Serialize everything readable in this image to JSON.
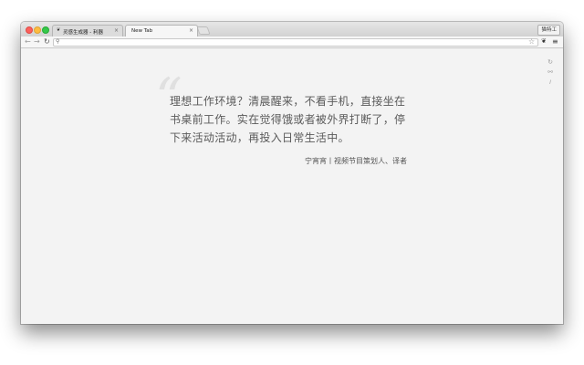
{
  "browser": {
    "tabs": [
      {
        "title": "灵感生成器 - 利器",
        "favicon": "zhihu-liqi-icon"
      },
      {
        "title": "New Tab"
      }
    ],
    "profile_label": "猫特工",
    "omnibox": {
      "value": "",
      "placeholder": ""
    }
  },
  "page": {
    "quote": "理想工作环境？清晨醒来，不看手机，直接坐在书桌前工作。实在觉得饿或者被外界打断了，停下来活动活动，再投入日常生活中。",
    "author": "宁宵宵丨视频节目策划人、译者",
    "quote_mark": "“"
  },
  "colors": {
    "close": "#fc605c",
    "minimize": "#fdbc40",
    "maximize": "#34c84a",
    "page_bg": "#f3f3f3",
    "quote_text": "#5a5a5a"
  }
}
